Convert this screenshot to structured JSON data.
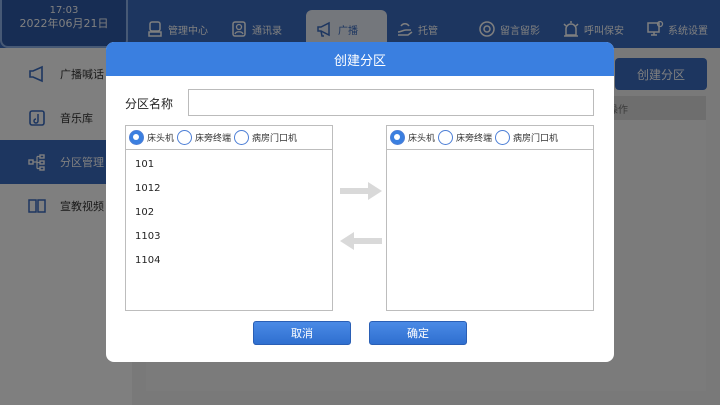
{
  "header": {
    "time": "17:03",
    "date": "2022年06月21日",
    "nav": [
      {
        "label": "管理中心",
        "icon": "admin-icon"
      },
      {
        "label": "通讯录",
        "icon": "contacts-icon"
      },
      {
        "label": "广播",
        "icon": "megaphone-icon"
      },
      {
        "label": "托管",
        "icon": "hand-icon"
      },
      {
        "label": "留言留影",
        "icon": "message-icon"
      },
      {
        "label": "呼叫保安",
        "icon": "alarm-icon"
      },
      {
        "label": "系统设置",
        "icon": "settings-icon"
      }
    ]
  },
  "sidebar": {
    "items": [
      {
        "label": "广播喊话",
        "icon": "speaker-icon"
      },
      {
        "label": "音乐库",
        "icon": "music-icon"
      },
      {
        "label": "分区管理",
        "icon": "partition-icon"
      },
      {
        "label": "宣教视频",
        "icon": "book-icon"
      }
    ]
  },
  "main": {
    "create_button": "创建分区",
    "column_header": "操作"
  },
  "dialog": {
    "title": "创建分区",
    "name_label": "分区名称",
    "name_value": "",
    "left_panel": {
      "radios": [
        "床头机",
        "床旁终端",
        "病房门口机"
      ],
      "selected": "床头机",
      "items": [
        "101",
        "1012",
        "102",
        "1103",
        "1104"
      ]
    },
    "right_panel": {
      "radios": [
        "床头机",
        "床旁终端",
        "病房门口机"
      ],
      "selected": "床头机",
      "items": []
    },
    "cancel_label": "取消",
    "ok_label": "确定"
  }
}
